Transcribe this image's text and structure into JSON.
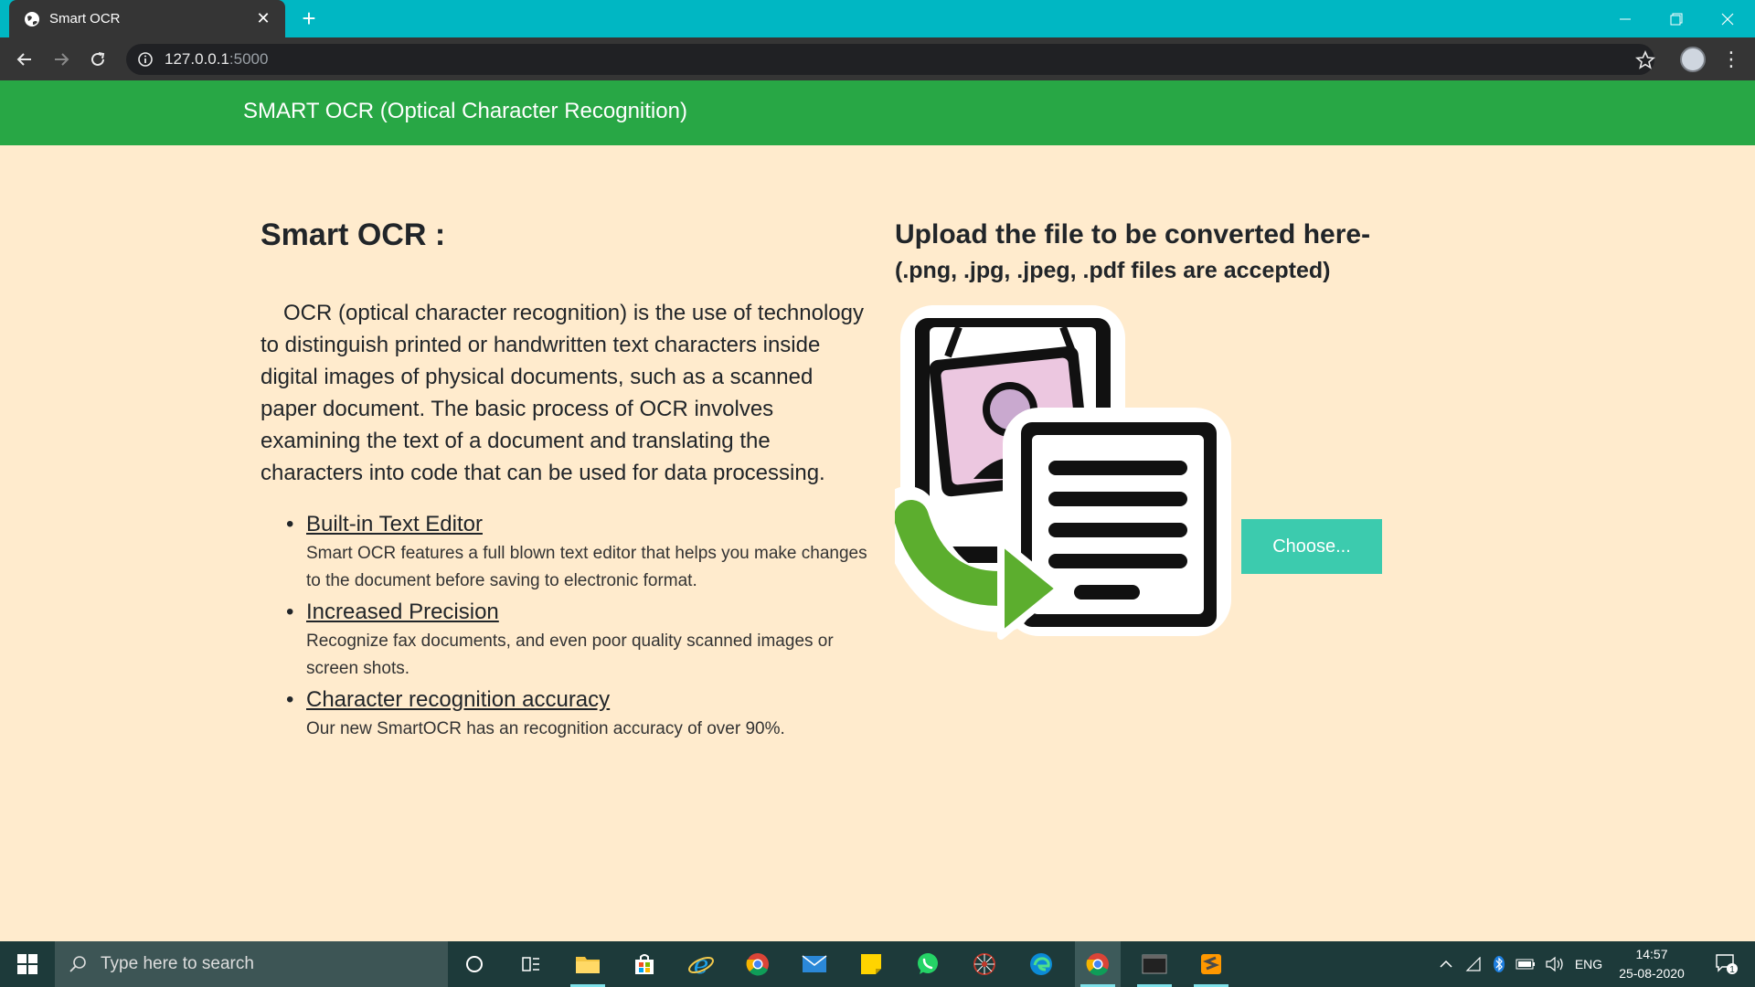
{
  "browser": {
    "tab_title": "Smart OCR",
    "close_tab": "✕",
    "new_tab": "+",
    "url_host": "127.0.0.1",
    "url_port": ":5000"
  },
  "navbar": {
    "brand": "SMART OCR (Optical Character Recognition)"
  },
  "main": {
    "heading": "Smart OCR :",
    "intro": "OCR (optical character recognition) is the use of technology to distinguish printed or handwritten text characters inside digital images of physical documents, such as a scanned paper document. The basic process of OCR involves examining the text of a document and translating the characters into code that can be used for data processing.",
    "features": [
      {
        "title": "Built-in Text Editor",
        "desc": "Smart OCR features a full blown text editor that helps you make changes to the document before saving to electronic format."
      },
      {
        "title": "Increased Precision",
        "desc": "Recognize fax documents, and even poor quality scanned images or screen shots."
      },
      {
        "title": "Character recognition accuracy",
        "desc": "Our new SmartOCR has an recognition accuracy of over 90%."
      }
    ]
  },
  "upload": {
    "title": "Upload the file to be converted here-",
    "subtitle": "(.png, .jpg, .jpeg, .pdf files are accepted)",
    "choose_label": "Choose..."
  },
  "taskbar": {
    "search_placeholder": "Type here to search",
    "language": "ENG",
    "time": "14:57",
    "date": "25-08-2020",
    "notification_count": "1"
  },
  "colors": {
    "navbar": "#28a745",
    "page_bg": "#ffebcd",
    "choose_button": "#3ccbae",
    "tabbar": "#00b7c3"
  }
}
